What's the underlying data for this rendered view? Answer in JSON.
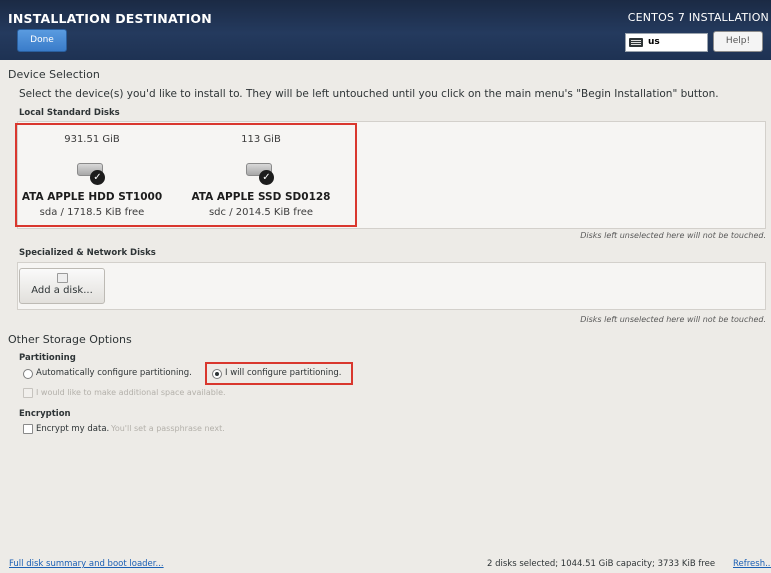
{
  "header": {
    "title": "INSTALLATION DESTINATION",
    "done_label": "Done",
    "product": "CENTOS 7 INSTALLATION",
    "keyboard_layout": "us",
    "help_label": "Help!"
  },
  "device_selection": {
    "title": "Device Selection",
    "description": "Select the device(s) you'd like to install to.  They will be left untouched until you click on the main menu's \"Begin Installation\" button.",
    "local_heading": "Local Standard Disks",
    "disks": [
      {
        "size": "931.51 GiB",
        "name": "ATA APPLE HDD ST1000",
        "info": "sda  /  1718.5 KiB free",
        "selected": true
      },
      {
        "size": "113 GiB",
        "name": "ATA APPLE SSD SD0128",
        "info": "sdc  /  2014.5 KiB free",
        "selected": true
      }
    ],
    "untouched_note": "Disks left unselected here will not be touched.",
    "specialized_heading": "Specialized & Network Disks",
    "add_disk_label": "Add a disk...",
    "untouched_note_2": "Disks left unselected here will not be touched."
  },
  "other_storage": {
    "title": "Other Storage Options",
    "partitioning_heading": "Partitioning",
    "auto_label": "Automatically configure partitioning.",
    "manual_label": "I will configure partitioning.",
    "selected_option": "manual",
    "extra_space_label": "I would like to make additional space available.",
    "encryption_heading": "Encryption",
    "encrypt_label": "Encrypt my data.",
    "encrypt_hint": "You'll set a passphrase next."
  },
  "footer": {
    "summary_link": "Full disk summary and boot loader...",
    "status": "2 disks selected; 1044.51 GiB capacity; 3733 KiB free",
    "refresh_link": "Refresh..."
  },
  "colors": {
    "header_bg": "#1e3253",
    "accent": "#3a7cc9",
    "highlight_box": "#d9372e",
    "link": "#1a5fb4"
  }
}
